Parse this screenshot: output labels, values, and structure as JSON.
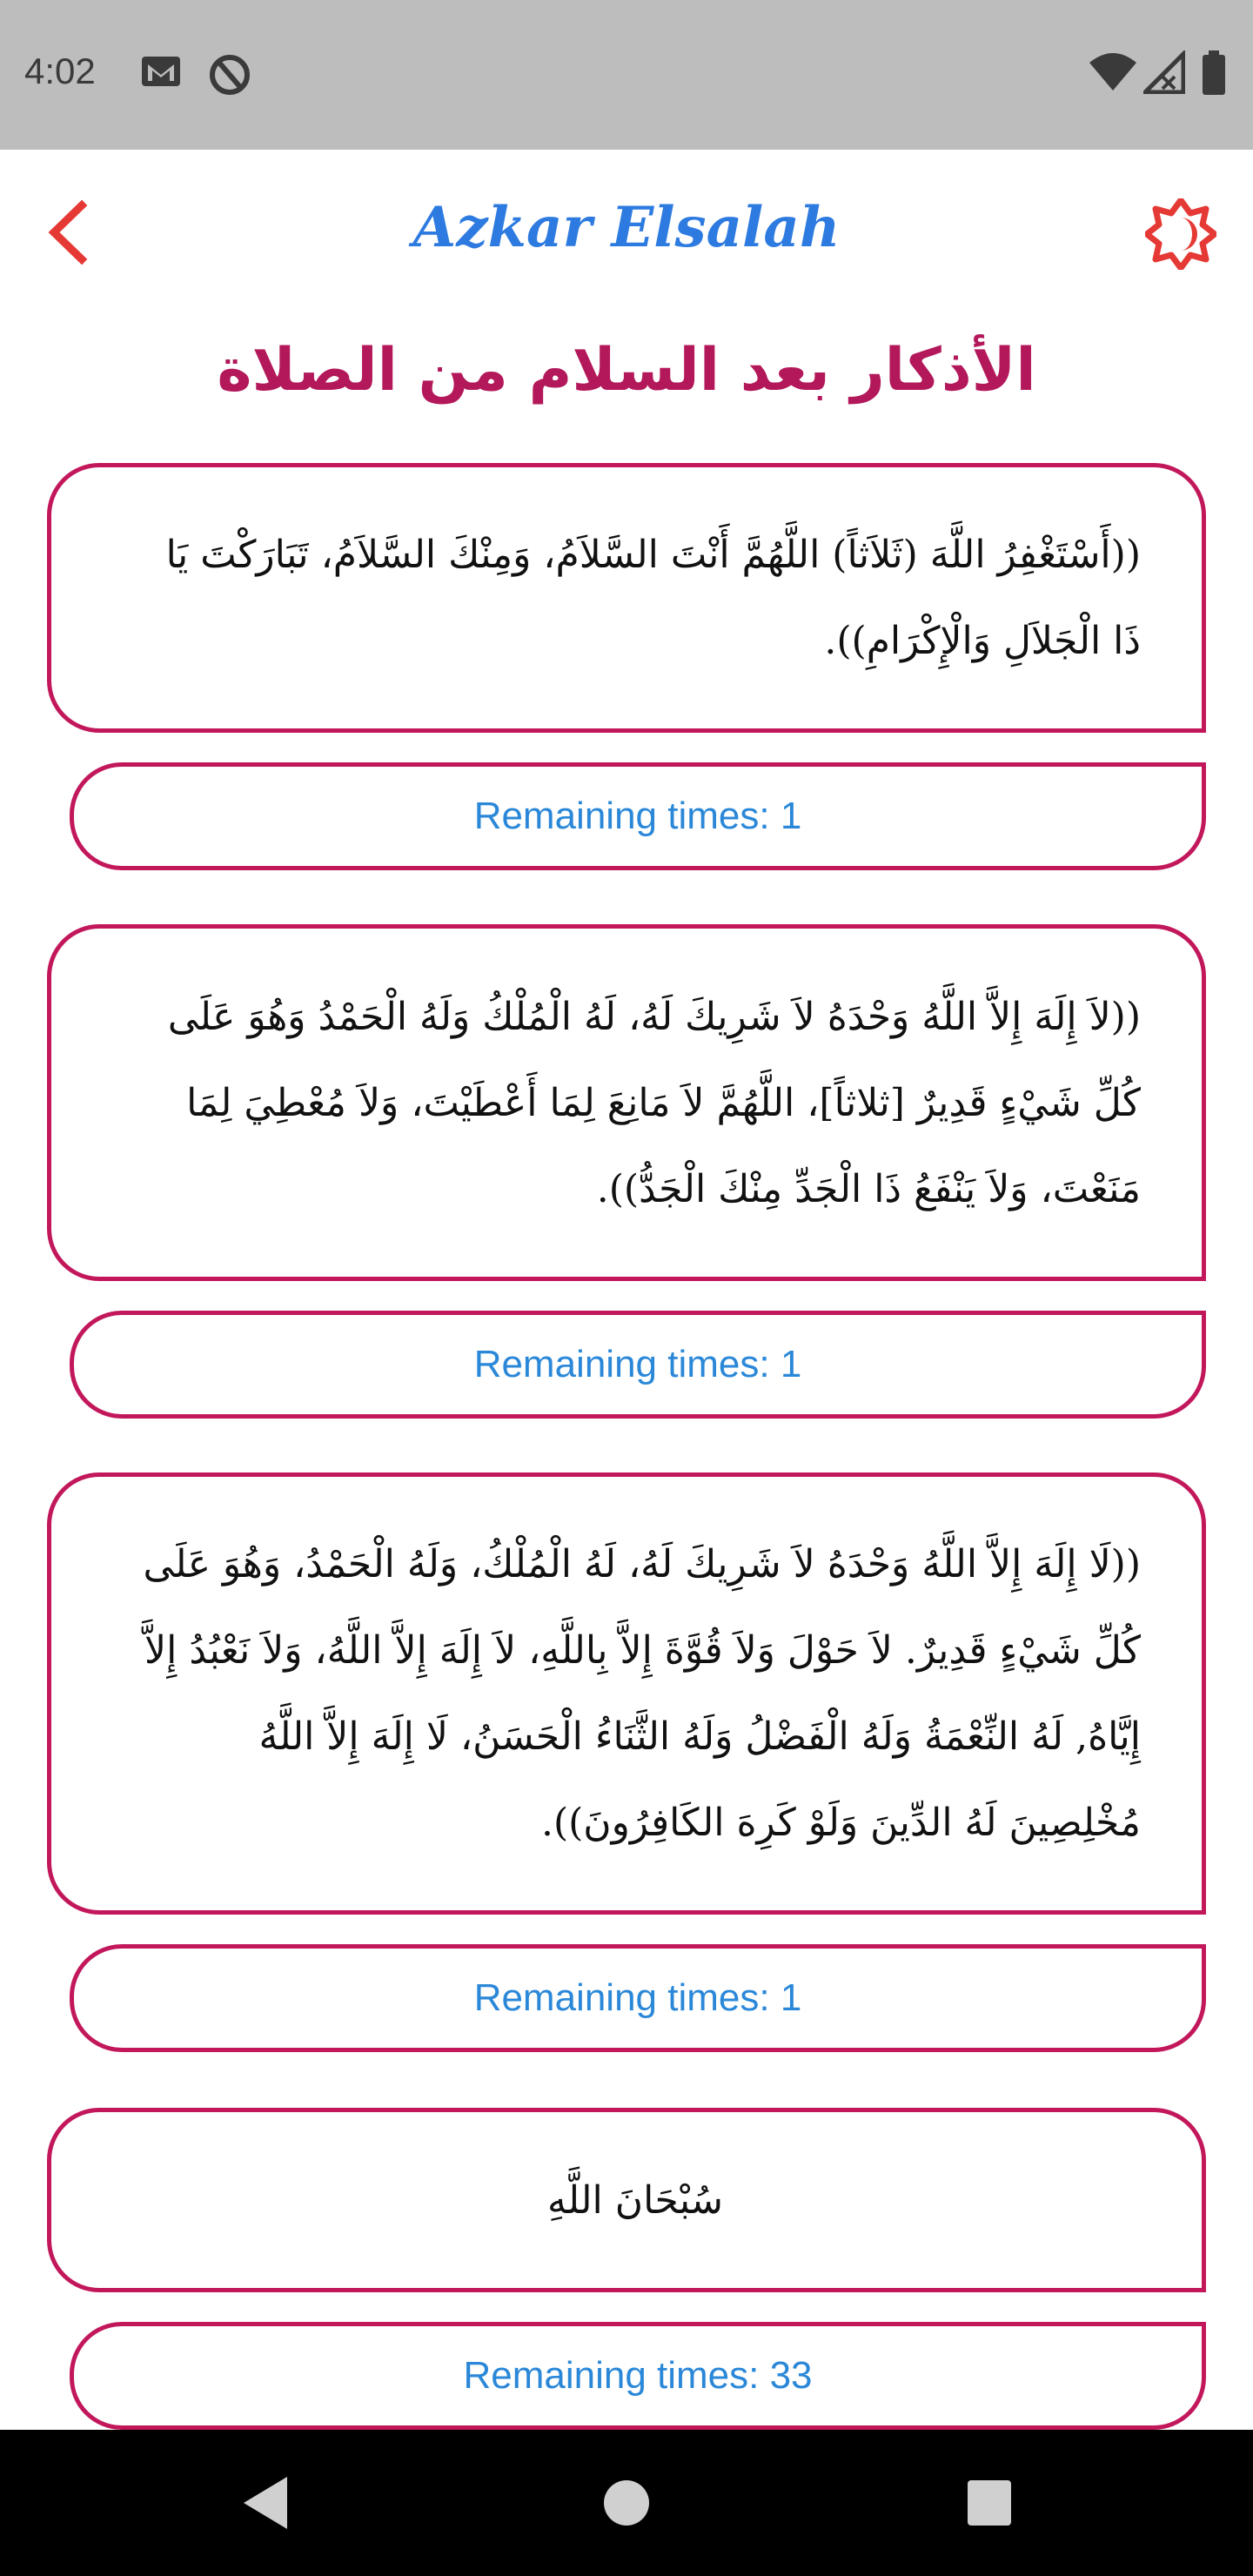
{
  "status_bar": {
    "time": "4:02",
    "icons": [
      "gmail-icon",
      "do-not-disturb-icon",
      "wifi-icon",
      "signal-icon",
      "battery-icon"
    ]
  },
  "app_bar": {
    "title": "Azkar Elsalah",
    "back_icon": "chevron-left-icon",
    "theme_icon": "brightness-icon",
    "accent_color": "#e53935",
    "title_color": "#2d7be0"
  },
  "page_title": "الأذكار بعد السلام من الصلاة",
  "azkar": [
    {
      "text": "((أَسْتَغْفِرُ اللَّهَ (ثَلاَثاً) اللَّهُمَّ أَنْتَ السَّلاَمُ، وَمِنْكَ السَّلاَمُ، تَبَارَكْتَ يَا ذَا الْجَلاَلِ وَالْإِكْرَامِ)).",
      "counter": "Remaining times: 1"
    },
    {
      "text": "((لاَ إِلَهَ إِلاَّ اللَّهُ وَحْدَهُ لاَ شَرِيكَ لَهُ، لَهُ الْمُلْكُ وَلَهُ الْحَمْدُ وَهُوَ عَلَى كُلِّ شَيْءٍ قَدِيرٌ [ثلاثاً]، اللَّهُمَّ لاَ مَانِعَ لِمَا أَعْطَيْتَ، وَلاَ مُعْطِيَ لِمَا مَنَعْتَ، وَلاَ يَنْفَعُ ذَا الْجَدِّ مِنْكَ الْجَدُّ)).",
      "counter": "Remaining times: 1"
    },
    {
      "text": "((لَا إِلَهَ إِلاَّ اللَّهُ وَحْدَهُ لاَ شَرِيكَ لَهُ، لَهُ الْمُلْكُ، وَلَهُ الْحَمْدُ، وَهُوَ عَلَى كُلِّ شَيْءٍ قَدِيرٌ. لاَ حَوْلَ وَلاَ قُوَّةَ إِلاَّ بِاللَّهِ، لاَ إِلَهَ إِلاَّ اللَّهُ، وَلاَ نَعْبُدُ إِلاَّ إِيَّاهُ, لَهُ النِّعْمَةُ وَلَهُ الْفَضْلُ وَلَهُ الثَّنَاءُ الْحَسَنُ، لَا إِلَهَ إِلاَّ اللَّهُ مُخْلِصِينَ لَهُ الدِّينَ وَلَوْ كَرِهَ الكَافِرُونَ)).",
      "counter": "Remaining times: 1"
    },
    {
      "text": "سُبْحَانَ اللَّهِ",
      "counter": "Remaining times: 33"
    }
  ],
  "colors": {
    "border": "#c2185b",
    "heading": "#b3185a",
    "counter_text": "#2b88d8"
  },
  "nav_bar": {
    "icons": [
      "back-triangle-icon",
      "home-circle-icon",
      "recents-square-icon"
    ]
  }
}
